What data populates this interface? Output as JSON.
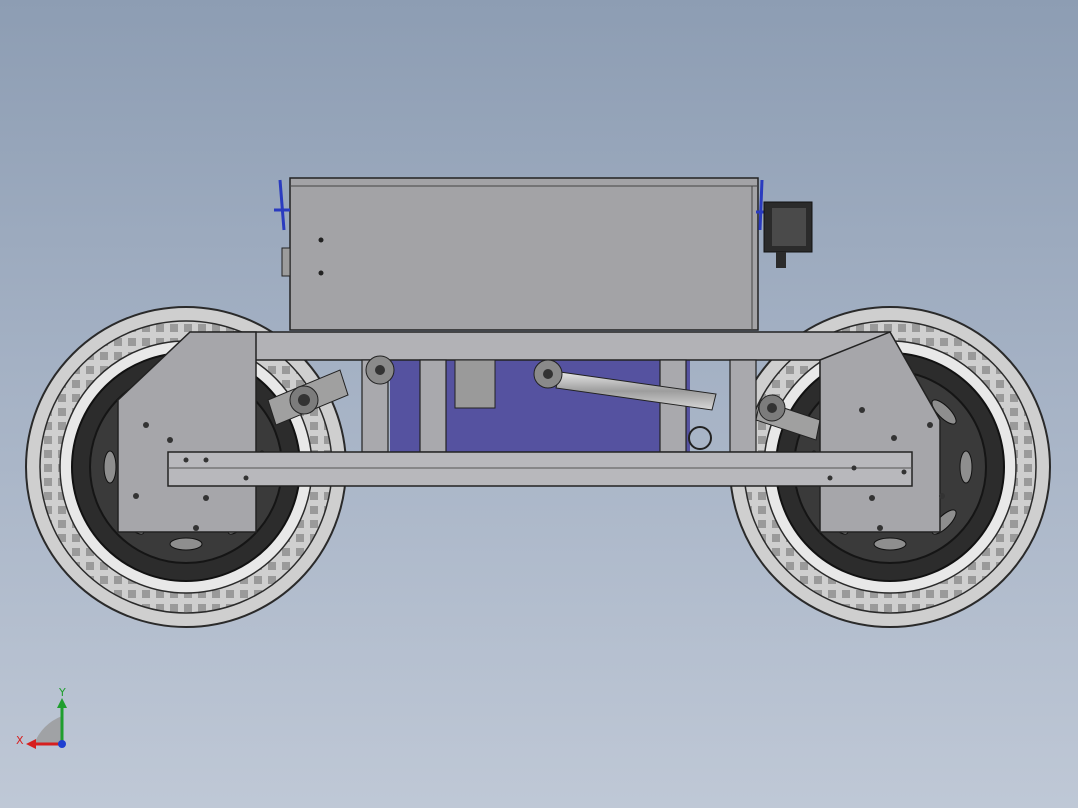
{
  "viewport": {
    "background_top": "#8d9db3",
    "background_bottom": "#bfc8d6"
  },
  "model": {
    "body_color": "#a3a3a6",
    "rail_color": "#b2b2b6",
    "tire_color": "#c9c9c9",
    "rim_color": "#2c2c2c",
    "interior_color": "#5552a0",
    "clamp_color": "#2a3bbf"
  },
  "triad": {
    "x_label": "X",
    "y_label": "Y",
    "x_color": "#d61f1f",
    "y_color": "#1f9e2e",
    "z_color": "#1e3fd1"
  }
}
